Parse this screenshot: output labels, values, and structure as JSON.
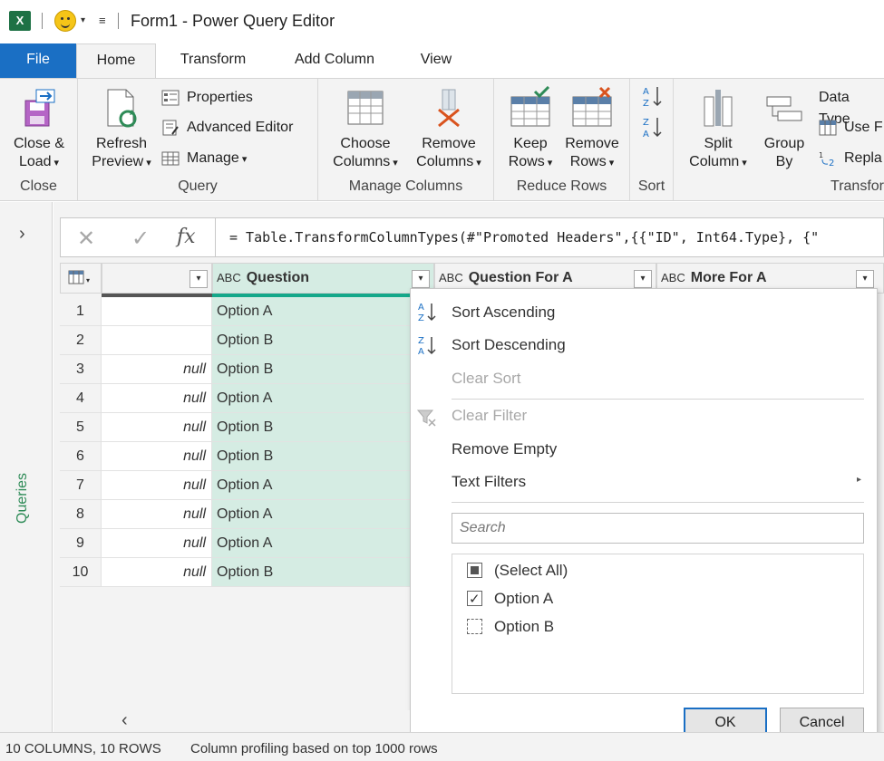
{
  "titlebar": {
    "app_icon": "X",
    "title": "Form1 - Power Query Editor"
  },
  "tabs": {
    "file": "File",
    "home": "Home",
    "transform": "Transform",
    "add_column": "Add Column",
    "view": "View"
  },
  "ribbon": {
    "close_group": {
      "label": "Close",
      "close_load_1": "Close &",
      "close_load_2": "Load"
    },
    "query_group": {
      "label": "Query",
      "refresh_1": "Refresh",
      "refresh_2": "Preview",
      "properties": "Properties",
      "advanced_editor": "Advanced Editor",
      "manage": "Manage"
    },
    "manage_columns_group": {
      "label": "Manage Columns",
      "choose_1": "Choose",
      "choose_2": "Columns",
      "remove_1": "Remove",
      "remove_2": "Columns"
    },
    "reduce_rows_group": {
      "label": "Reduce Rows",
      "keep_1": "Keep",
      "keep_2": "Rows",
      "remove_1": "Remove",
      "remove_2": "Rows"
    },
    "sort_group": {
      "label": "Sort"
    },
    "transform_group": {
      "label": "Transfor",
      "split_1": "Split",
      "split_2": "Column",
      "group_1": "Group",
      "group_2": "By",
      "data_type": "Data Type",
      "use_first": "Use F",
      "replace": "Repla"
    }
  },
  "queries_pane": {
    "label": "Queries"
  },
  "formula_bar": {
    "fx": "fx",
    "text": "= Table.TransformColumnTypes(#\"Promoted Headers\",{{\"ID\", Int64.Type}, {\""
  },
  "grid": {
    "columns": [
      "",
      "Question",
      "Question For A",
      "More For A"
    ],
    "type_icon": "ABC",
    "rows": [
      {
        "n": "1",
        "c1": "",
        "q": "Option A"
      },
      {
        "n": "2",
        "c1": "",
        "q": "Option B"
      },
      {
        "n": "3",
        "c1": "null",
        "q": "Option B"
      },
      {
        "n": "4",
        "c1": "null",
        "q": "Option A"
      },
      {
        "n": "5",
        "c1": "null",
        "q": "Option B"
      },
      {
        "n": "6",
        "c1": "null",
        "q": "Option B"
      },
      {
        "n": "7",
        "c1": "null",
        "q": "Option A"
      },
      {
        "n": "8",
        "c1": "null",
        "q": "Option A"
      },
      {
        "n": "9",
        "c1": "null",
        "q": "Option A"
      },
      {
        "n": "10",
        "c1": "null",
        "q": "Option B"
      }
    ]
  },
  "menu": {
    "sort_asc": "Sort Ascending",
    "sort_desc": "Sort Descending",
    "clear_sort": "Clear Sort",
    "clear_filter": "Clear Filter",
    "remove_empty": "Remove Empty",
    "text_filters": "Text Filters",
    "search_placeholder": "Search",
    "items": [
      "(Select All)",
      "Option A",
      "Option B"
    ],
    "ok": "OK",
    "cancel": "Cancel"
  },
  "status": {
    "summary": "10 COLUMNS, 10 ROWS",
    "profiling": "Column profiling based on top 1000 rows"
  },
  "colors": {
    "accent": "#1a6fc4",
    "selected_column": "#d5ece3",
    "excel_green": "#1e7145"
  }
}
